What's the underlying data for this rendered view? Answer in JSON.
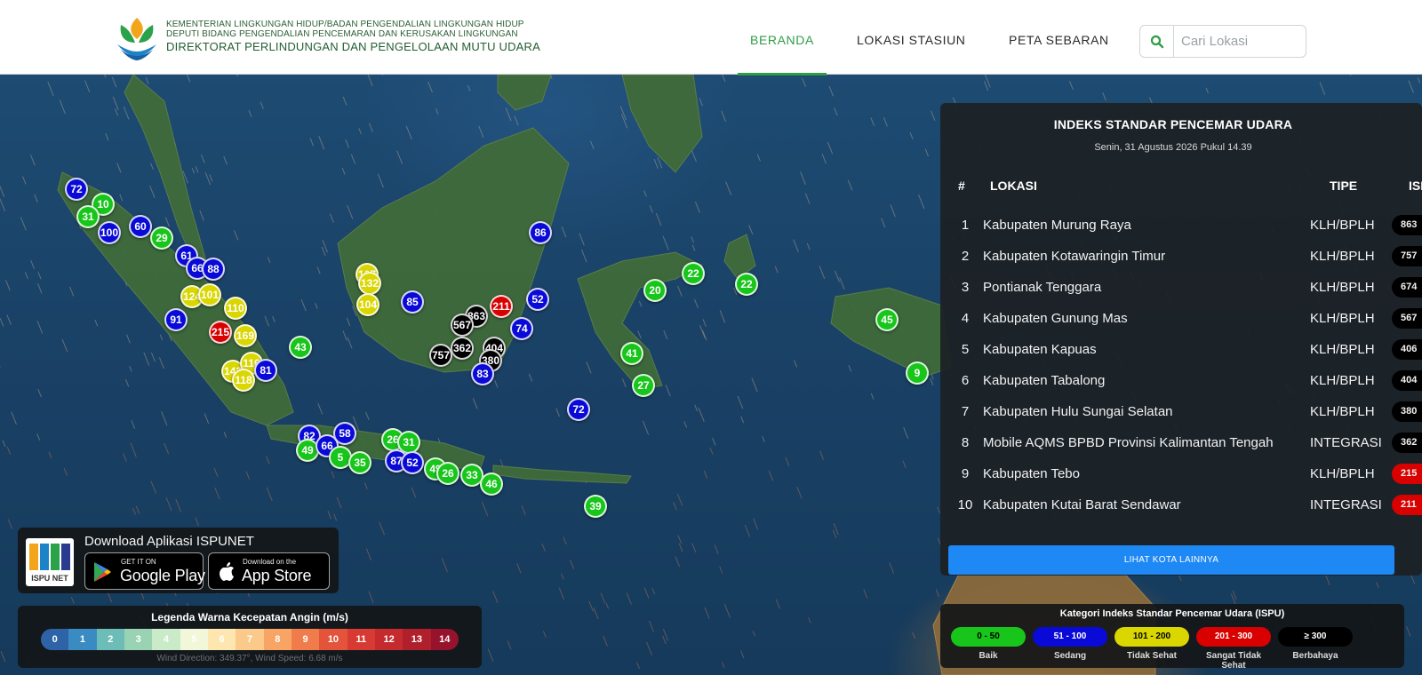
{
  "header": {
    "org_line1": "KEMENTERIAN LINGKUNGAN HIDUP/BADAN PENGENDALIAN LINGKUNGAN HIDUP",
    "org_line2": "DEPUTI BIDANG PENGENDALIAN PENCEMARAN DAN KERUSAKAN LINGKUNGAN",
    "org_line3": "DIREKTORAT PERLINDUNGAN DAN PENGELOLAAN MUTU UDARA",
    "nav": [
      "BERANDA",
      "LOKASI STASIUN",
      "PETA SEBARAN"
    ],
    "active_nav": "BERANDA",
    "search_placeholder": "Cari Lokasi"
  },
  "colors": {
    "baik": "#18c51a",
    "sedang": "#0a0ad8",
    "tidak_sehat": "#d9d600",
    "sangat_tidak_sehat": "#d90000",
    "berbahaya": "#000000",
    "accent": "#2f9d47",
    "button_blue": "#1e88f5"
  },
  "panel": {
    "title": "INDEKS STANDAR PENCEMAR UDARA",
    "date": "Senin, 31 Agustus 2026 Pukul 14.39",
    "headers": {
      "num": "#",
      "lokasi": "LOKASI",
      "tipe": "TIPE",
      "ispu": "ISPU"
    },
    "rows": [
      {
        "rank": "1",
        "lokasi": "Kabupaten Murung Raya",
        "tipe": "KLH/BPLH",
        "ispu": "863",
        "category": "berbahaya"
      },
      {
        "rank": "2",
        "lokasi": "Kabupaten Kotawaringin Timur",
        "tipe": "KLH/BPLH",
        "ispu": "757",
        "category": "berbahaya"
      },
      {
        "rank": "3",
        "lokasi": "Pontianak Tenggara",
        "tipe": "KLH/BPLH",
        "ispu": "674",
        "category": "berbahaya"
      },
      {
        "rank": "4",
        "lokasi": "Kabupaten Gunung Mas",
        "tipe": "KLH/BPLH",
        "ispu": "567",
        "category": "berbahaya"
      },
      {
        "rank": "5",
        "lokasi": "Kabupaten Kapuas",
        "tipe": "KLH/BPLH",
        "ispu": "406",
        "category": "berbahaya"
      },
      {
        "rank": "6",
        "lokasi": "Kabupaten Tabalong",
        "tipe": "KLH/BPLH",
        "ispu": "404",
        "category": "berbahaya"
      },
      {
        "rank": "7",
        "lokasi": "Kabupaten Hulu Sungai Selatan",
        "tipe": "KLH/BPLH",
        "ispu": "380",
        "category": "berbahaya"
      },
      {
        "rank": "8",
        "lokasi": "Mobile AQMS BPBD Provinsi Kalimantan Tengah",
        "tipe": "INTEGRASI",
        "ispu": "362",
        "category": "berbahaya"
      },
      {
        "rank": "9",
        "lokasi": "Kabupaten Tebo",
        "tipe": "KLH/BPLH",
        "ispu": "215",
        "category": "sangat_tidak_sehat"
      },
      {
        "rank": "10",
        "lokasi": "Kabupaten Kutai Barat Sendawar",
        "tipe": "INTEGRASI",
        "ispu": "211",
        "category": "sangat_tidak_sehat"
      }
    ],
    "more_button": "LIHAT KOTA LAINNYA"
  },
  "app_download": {
    "title": "Download Aplikasi ISPUNET",
    "logo_text": "ISPU NET",
    "google_small": "GET IT ON",
    "google_big": "Google Play",
    "apple_small": "Download on the",
    "apple_big": "App Store"
  },
  "wind_legend": {
    "title": "Legenda Warna Kecepatan Angin (m/s)",
    "scale": [
      "0",
      "1",
      "2",
      "3",
      "4",
      "5",
      "6",
      "7",
      "8",
      "9",
      "10",
      "11",
      "12",
      "13",
      "14"
    ],
    "scale_colors": [
      "#2f63a8",
      "#3a8bc1",
      "#6cbcb7",
      "#99d3b4",
      "#c9ebc7",
      "#f3f7d9",
      "#fde6b0",
      "#fbc98a",
      "#f7a465",
      "#f07c4b",
      "#e3543b",
      "#d73a32",
      "#c52a2e",
      "#b01f2c",
      "#96132b"
    ],
    "info": "Wind Direction: 349.37°, Wind Speed: 6.68 m/s"
  },
  "ispu_legend": {
    "title": "Kategori Indeks Standar Pencemar Udara (ISPU)",
    "categories": [
      {
        "range": "0 - 50",
        "label": "Baik",
        "color": "#18c51a",
        "text_color": "#000000"
      },
      {
        "range": "51 - 100",
        "label": "Sedang",
        "color": "#0a0ad8",
        "text_color": "#ffffff"
      },
      {
        "range": "101 - 200",
        "label": "Tidak Sehat",
        "color": "#d9d600",
        "text_color": "#000000"
      },
      {
        "range": "201 - 300",
        "label": "Sangat Tidak Sehat",
        "color": "#d90000",
        "text_color": "#ffffff"
      },
      {
        "range": "≥ 300",
        "label": "Berbahaya",
        "color": "#000000",
        "text_color": "#ffffff"
      }
    ]
  },
  "map_markers": [
    {
      "v": "72",
      "c": "sedang"
    },
    {
      "v": "10",
      "c": "baik"
    },
    {
      "v": "31",
      "c": "baik"
    },
    {
      "v": "100",
      "c": "sedang"
    },
    {
      "v": "60",
      "c": "sedang"
    },
    {
      "v": "29",
      "c": "baik"
    },
    {
      "v": "61",
      "c": "sedang"
    },
    {
      "v": "66",
      "c": "sedang"
    },
    {
      "v": "88",
      "c": "sedang"
    },
    {
      "v": "124",
      "c": "tidak_sehat"
    },
    {
      "v": "101",
      "c": "tidak_sehat"
    },
    {
      "v": "110",
      "c": "tidak_sehat"
    },
    {
      "v": "91",
      "c": "sedang"
    },
    {
      "v": "215",
      "c": "sangat_tidak_sehat"
    },
    {
      "v": "169",
      "c": "tidak_sehat"
    },
    {
      "v": "43",
      "c": "baik"
    },
    {
      "v": "142",
      "c": "tidak_sehat"
    },
    {
      "v": "116",
      "c": "tidak_sehat"
    },
    {
      "v": "81",
      "c": "sedang"
    },
    {
      "v": "118",
      "c": "tidak_sehat"
    },
    {
      "v": "167",
      "c": "tidak_sehat"
    },
    {
      "v": "132",
      "c": "tidak_sehat"
    },
    {
      "v": "104",
      "c": "tidak_sehat"
    },
    {
      "v": "85",
      "c": "sedang"
    },
    {
      "v": "863",
      "c": "berbahaya"
    },
    {
      "v": "211",
      "c": "sangat_tidak_sehat"
    },
    {
      "v": "567",
      "c": "berbahaya"
    },
    {
      "v": "362",
      "c": "berbahaya"
    },
    {
      "v": "404",
      "c": "berbahaya"
    },
    {
      "v": "757",
      "c": "berbahaya"
    },
    {
      "v": "380",
      "c": "berbahaya"
    },
    {
      "v": "83",
      "c": "sedang"
    },
    {
      "v": "52",
      "c": "sedang"
    },
    {
      "v": "74",
      "c": "sedang"
    },
    {
      "v": "86",
      "c": "sedang"
    },
    {
      "v": "20",
      "c": "baik"
    },
    {
      "v": "22",
      "c": "baik"
    },
    {
      "v": "22",
      "c": "baik"
    },
    {
      "v": "45",
      "c": "baik"
    },
    {
      "v": "41",
      "c": "baik"
    },
    {
      "v": "27",
      "c": "baik"
    },
    {
      "v": "9",
      "c": "baik"
    },
    {
      "v": "72",
      "c": "sedang"
    },
    {
      "v": "39",
      "c": "baik"
    },
    {
      "v": "82",
      "c": "sedang"
    },
    {
      "v": "58",
      "c": "sedang"
    },
    {
      "v": "49",
      "c": "baik"
    },
    {
      "v": "66",
      "c": "sedang"
    },
    {
      "v": "5",
      "c": "baik"
    },
    {
      "v": "35",
      "c": "baik"
    },
    {
      "v": "26",
      "c": "baik"
    },
    {
      "v": "31",
      "c": "baik"
    },
    {
      "v": "87",
      "c": "sedang"
    },
    {
      "v": "52",
      "c": "sedang"
    },
    {
      "v": "49",
      "c": "baik"
    },
    {
      "v": "26",
      "c": "baik"
    },
    {
      "v": "33",
      "c": "baik"
    },
    {
      "v": "46",
      "c": "baik"
    }
  ]
}
